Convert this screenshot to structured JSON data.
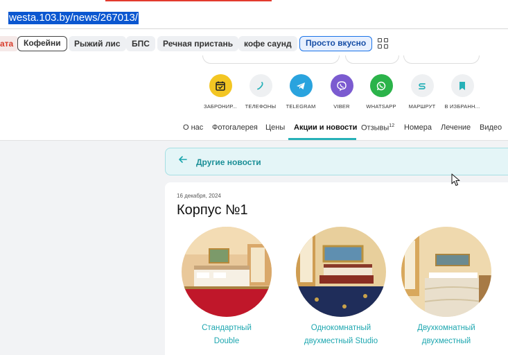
{
  "browser": {
    "url": "westa.103.by/news/267013/"
  },
  "bookmarks": {
    "items": [
      {
        "label": "ата",
        "state": "partial"
      },
      {
        "label": "Кофейни",
        "state": "outlined"
      },
      {
        "label": "Рыжий лис",
        "state": "normal"
      },
      {
        "label": "БПС",
        "state": "normal"
      },
      {
        "label": "Речная пристань",
        "state": "normal"
      },
      {
        "label": "кофе саунд",
        "state": "normal"
      },
      {
        "label": "Просто вкусно",
        "state": "active"
      }
    ],
    "grid_icon": "apps-grid-icon"
  },
  "actions": [
    {
      "label": "ЗАБРОНИР...",
      "icon": "calendar-check-icon",
      "color": "#f3c623"
    },
    {
      "label": "ТЕЛЕФОНЫ",
      "icon": "phone-icon",
      "color": "#eef0f2"
    },
    {
      "label": "TELEGRAM",
      "icon": "telegram-icon",
      "color": "#2aa3de"
    },
    {
      "label": "VIBER",
      "icon": "viber-icon",
      "color": "#7b5bd0"
    },
    {
      "label": "WHATSAPP",
      "icon": "whatsapp-icon",
      "color": "#2bb34a"
    },
    {
      "label": "МАРШРУТ",
      "icon": "route-icon",
      "color": "#eef0f2"
    },
    {
      "label": "В ИЗБРАНН...",
      "icon": "bookmark-icon",
      "color": "#eef0f2"
    }
  ],
  "tabs": [
    {
      "label": "О нас"
    },
    {
      "label": "Фотогалерея"
    },
    {
      "label": "Цены"
    },
    {
      "label": "Акции и новости",
      "active": true
    },
    {
      "label": "Отзывы",
      "badge": "12"
    },
    {
      "label": "Номера"
    },
    {
      "label": "Лечение"
    },
    {
      "label": "Видео"
    }
  ],
  "news": {
    "back_label": "Другие новости",
    "date": "16 декабря, 2024",
    "title": "Корпус №1",
    "rooms": [
      {
        "line1": "Стандартный",
        "line2": "Double"
      },
      {
        "line1": "Однокомнатный",
        "line2": "двухместный Studio"
      },
      {
        "line1": "Двухкомнатный",
        "line2": "двухместный"
      }
    ]
  },
  "colors": {
    "accent": "#27b1b8",
    "link": "#1ea7b0",
    "url_highlight": "#0b57d0"
  }
}
